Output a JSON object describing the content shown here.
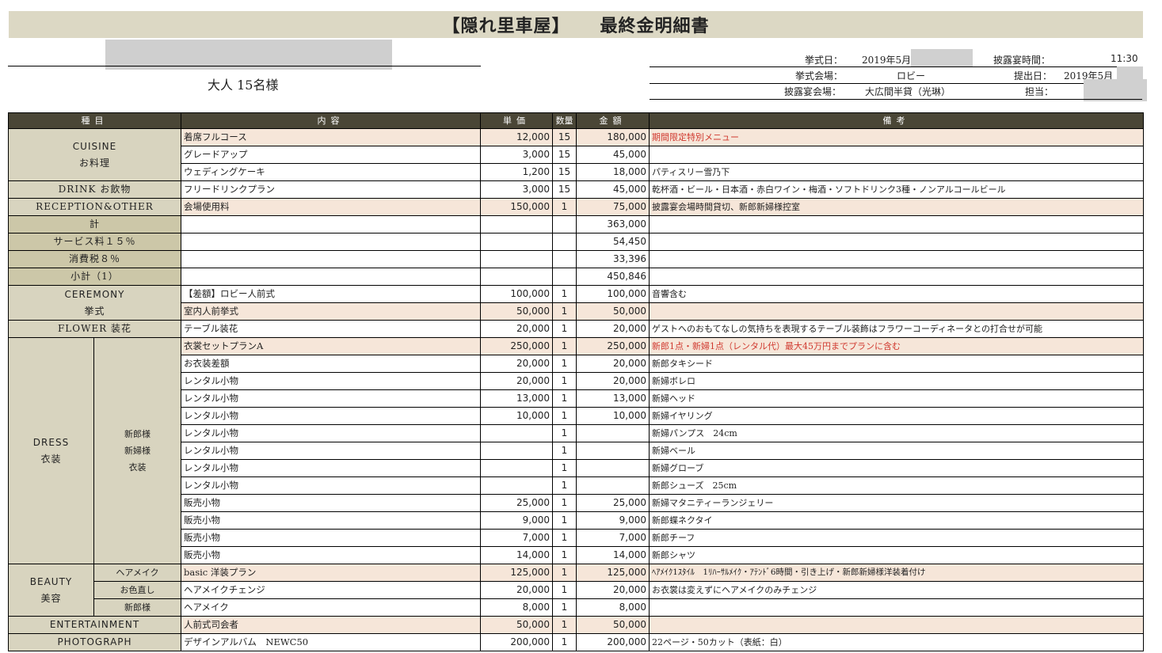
{
  "title": {
    "venue": "【隠れ里車屋】",
    "doc": "最終金明細書"
  },
  "client": {
    "guests": "大人 15名様"
  },
  "meta": {
    "ceremony_date_label": "挙式日：",
    "ceremony_date": "2019年5月",
    "reception_time_label": "披露宴時間：",
    "reception_time": "11:30",
    "ceremony_venue_label": "挙式会場：",
    "ceremony_venue": "ロビー",
    "submit_date_label": "提出日：",
    "submit_date": "2019年5月",
    "reception_venue_label": "披露宴会場：",
    "reception_venue": "大広間半貸（光琳）",
    "staff_label": "担当："
  },
  "headers": {
    "category": "種目",
    "content": "内容",
    "unit": "単価",
    "qty": "数量",
    "amount": "金額",
    "remarks": "備考"
  },
  "categories": {
    "cuisine_en": "CUISINE",
    "cuisine_jp": "お料理",
    "drink": "DRINK お飲物",
    "reception": "RECEPTION&OTHER",
    "total": "計",
    "service": "サービス料１５％",
    "tax": "消費税８％",
    "subtotal": "小計（1）",
    "ceremony_en": "CEREMONY",
    "ceremony_jp": "挙式",
    "flower": "FLOWER 装花",
    "dress_en": "DRESS",
    "dress_jp": "衣装",
    "dress_sub1": "新郎様",
    "dress_sub2": "新婦様",
    "dress_sub3": "衣装",
    "beauty_en": "BEAUTY",
    "beauty_jp": "美容",
    "beauty_sub1": "ヘアメイク",
    "beauty_sub2": "お色直し",
    "beauty_sub3": "新郎様",
    "entertainment": "ENTERTAINMENT",
    "photograph": "PHOTOGRAPH"
  },
  "rows": [
    {
      "desc": "着席フルコース",
      "unit": "12,000",
      "qty": "15",
      "amount": "180,000",
      "note": "期間限定特別メニュー"
    },
    {
      "desc": "グレードアップ",
      "unit": "3,000",
      "qty": "15",
      "amount": "45,000",
      "note": ""
    },
    {
      "desc": "ウェディングケーキ",
      "unit": "1,200",
      "qty": "15",
      "amount": "18,000",
      "note": "パティスリー雪乃下"
    },
    {
      "desc": "フリードリンクプラン",
      "unit": "3,000",
      "qty": "15",
      "amount": "45,000",
      "note": "乾杯酒・ビール・日本酒・赤白ワイン・梅酒・ソフトドリンク3種・ノンアルコールビール"
    },
    {
      "desc": "会場使用料",
      "unit": "150,000",
      "qty": "1",
      "amount": "75,000",
      "note": "披露宴会場時間貸切、新郎新婦様控室"
    },
    {
      "desc": "",
      "unit": "",
      "qty": "",
      "amount": "363,000",
      "note": ""
    },
    {
      "desc": "",
      "unit": "",
      "qty": "",
      "amount": "54,450",
      "note": ""
    },
    {
      "desc": "",
      "unit": "",
      "qty": "",
      "amount": "33,396",
      "note": ""
    },
    {
      "desc": "",
      "unit": "",
      "qty": "",
      "amount": "450,846",
      "note": ""
    },
    {
      "desc": "【差額】ロビー人前式",
      "unit": "100,000",
      "qty": "1",
      "amount": "100,000",
      "note": "音響含む"
    },
    {
      "desc": "室内人前挙式",
      "unit": "50,000",
      "qty": "1",
      "amount": "50,000",
      "note": ""
    },
    {
      "desc": "テーブル装花",
      "unit": "20,000",
      "qty": "1",
      "amount": "20,000",
      "note": "ゲストへのおもてなしの気持ちを表現するテーブル装飾はフラワーコーディネータとの打合せが可能"
    },
    {
      "desc": "衣裳セットプランA",
      "unit": "250,000",
      "qty": "1",
      "amount": "250,000",
      "note": "新郎1点・新婦1点（レンタル代）最大45万円までプランに含む"
    },
    {
      "desc": "お衣装差額",
      "unit": "20,000",
      "qty": "1",
      "amount": "20,000",
      "note": "新郎タキシード"
    },
    {
      "desc": "レンタル小物",
      "unit": "20,000",
      "qty": "1",
      "amount": "20,000",
      "note": "新婦ボレロ"
    },
    {
      "desc": "レンタル小物",
      "unit": "13,000",
      "qty": "1",
      "amount": "13,000",
      "note": "新婦ヘッド"
    },
    {
      "desc": "レンタル小物",
      "unit": "10,000",
      "qty": "1",
      "amount": "10,000",
      "note": "新婦イヤリング"
    },
    {
      "desc": "レンタル小物",
      "unit": "",
      "qty": "1",
      "amount": "",
      "note": "新婦パンプス　24cm"
    },
    {
      "desc": "レンタル小物",
      "unit": "",
      "qty": "1",
      "amount": "",
      "note": "新婦ベール"
    },
    {
      "desc": "レンタル小物",
      "unit": "",
      "qty": "1",
      "amount": "",
      "note": "新婦グローブ"
    },
    {
      "desc": "レンタル小物",
      "unit": "",
      "qty": "1",
      "amount": "",
      "note": "新郎シューズ　25cm"
    },
    {
      "desc": "販売小物",
      "unit": "25,000",
      "qty": "1",
      "amount": "25,000",
      "note": "新婦マタニティーランジェリー"
    },
    {
      "desc": "販売小物",
      "unit": "9,000",
      "qty": "1",
      "amount": "9,000",
      "note": "新郎蝶ネクタイ"
    },
    {
      "desc": "販売小物",
      "unit": "7,000",
      "qty": "1",
      "amount": "7,000",
      "note": "新郎チーフ"
    },
    {
      "desc": "販売小物",
      "unit": "14,000",
      "qty": "1",
      "amount": "14,000",
      "note": "新郎シャツ"
    },
    {
      "desc": "basic 洋装プラン",
      "unit": "125,000",
      "qty": "1",
      "amount": "125,000",
      "note": "ﾍｱﾒｲｸ1ｽﾀｲﾙ　1ﾘﾊｰｻﾙﾒｲｸ・ｱﾃﾝﾄﾞ6時間・引き上げ・新郎新婦様洋装着付け"
    },
    {
      "desc": "ヘアメイクチェンジ",
      "unit": "20,000",
      "qty": "1",
      "amount": "20,000",
      "note": "お衣裳は変えずにヘアメイクのみチェンジ"
    },
    {
      "desc": "ヘアメイク",
      "unit": "8,000",
      "qty": "1",
      "amount": "8,000",
      "note": ""
    },
    {
      "desc": "人前式司会者",
      "unit": "50,000",
      "qty": "1",
      "amount": "50,000",
      "note": ""
    },
    {
      "desc": "デザインアルバム　NEWC50",
      "unit": "200,000",
      "qty": "1",
      "amount": "200,000",
      "note": "22ページ・50カット（表紙：白）"
    }
  ]
}
